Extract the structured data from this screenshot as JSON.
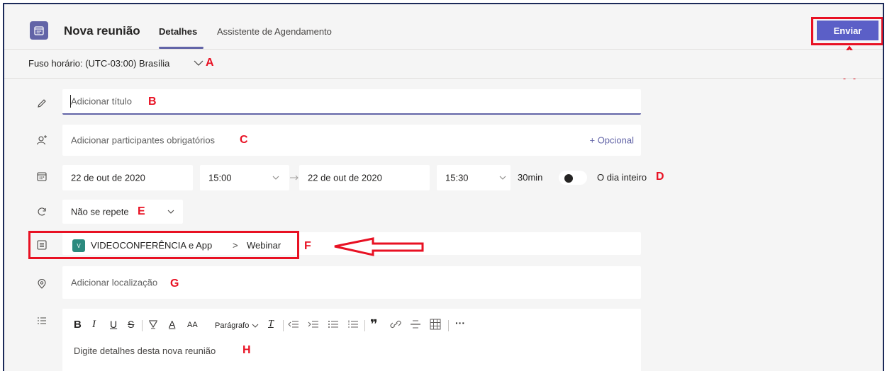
{
  "header": {
    "title": "Nova reunião",
    "tabs": [
      "Detalhes",
      "Assistente de Agendamento"
    ],
    "send_label": "Enviar"
  },
  "timezone": {
    "label": "Fuso horário: (UTC-03:00) Brasília"
  },
  "title_field": {
    "placeholder": "Adicionar título"
  },
  "attendees": {
    "placeholder": "Adicionar participantes obrigatórios",
    "optional_label": "+ Opcional"
  },
  "schedule": {
    "start_date": "22 de out de 2020",
    "start_time": "15:00",
    "end_date": "22 de out de 2020",
    "end_time": "15:30",
    "duration": "30min",
    "all_day_label": "O dia inteiro",
    "all_day": false
  },
  "repeat": {
    "value": "Não se repete"
  },
  "channel": {
    "badge": "V",
    "team": "VIDEOCONFERÊNCIA e App",
    "separator": ">",
    "channel": "Webinar"
  },
  "location": {
    "placeholder": "Adicionar localização"
  },
  "editor": {
    "paragraph_label": "Parágrafo",
    "placeholder": "Digite detalhes desta nova reunião"
  },
  "markers": {
    "a": "A",
    "b": "B",
    "c": "C",
    "d": "D",
    "e": "E",
    "f": "F",
    "g": "G",
    "h": "H"
  },
  "colors": {
    "accent": "#6264a7",
    "annotation": "#e81123",
    "send": "#5b5fc7"
  }
}
